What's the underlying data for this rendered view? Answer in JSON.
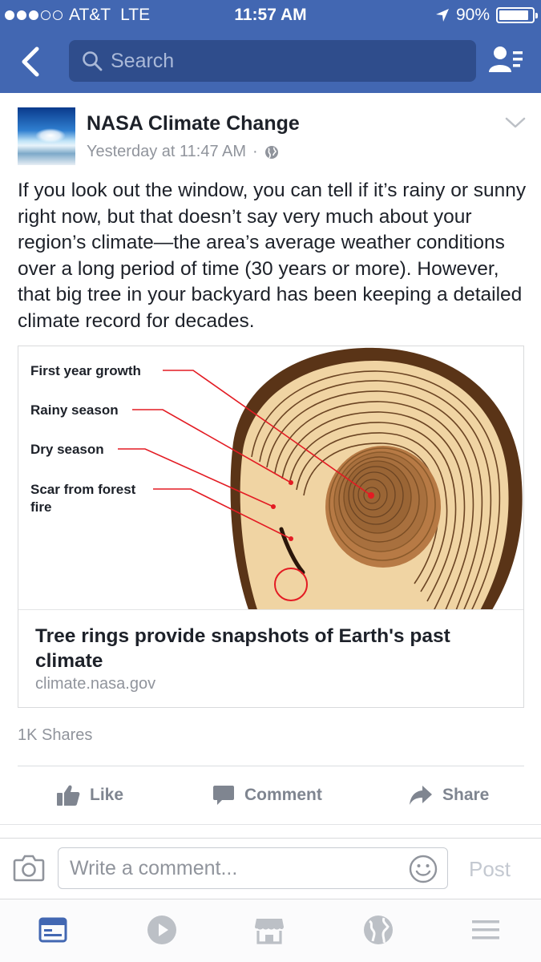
{
  "status_bar": {
    "signal_bars_filled": 3,
    "signal_bars_total": 5,
    "carrier": "AT&T",
    "network": "LTE",
    "time": "11:57 AM",
    "battery_text": "90%",
    "battery_level": 0.9
  },
  "nav": {
    "back_icon": "chevron-left-icon",
    "search_placeholder": "Search",
    "friends_icon": "friend-requests-icon"
  },
  "post": {
    "page_name": "NASA Climate Change",
    "timestamp": "Yesterday at 11:47 AM",
    "separator": "·",
    "audience_icon": "globe-icon",
    "text": "If you look out the window, you can tell if it’s rainy or sunny right now, but that doesn’t say very much about your region’s climate—the area’s average weather conditions over a long period of time (30 years or more). However, that big tree in your backyard has been keeping a detailed climate record for decades.",
    "link": {
      "image_labels": {
        "first_year": "First year growth",
        "rainy": "Rainy season",
        "dry": "Dry season",
        "scar_line1": "Scar from forest",
        "scar_line2": "fire"
      },
      "title": "Tree rings provide snapshots of Earth's past climate",
      "domain": "climate.nasa.gov"
    },
    "shares_text": "1K Shares"
  },
  "actions": {
    "like": "Like",
    "comment": "Comment",
    "share": "Share"
  },
  "composer": {
    "placeholder": "Write a comment...",
    "post_label": "Post"
  },
  "tab_bar": {
    "items": [
      "news-feed-icon",
      "video-icon",
      "marketplace-icon",
      "notifications-globe-icon",
      "menu-icon"
    ],
    "active_index": 0
  },
  "colors": {
    "brand_blue": "#4267b2",
    "search_field": "#2f4d8c",
    "muted_text": "#90949c",
    "action_gray": "#7f8590",
    "ring_light": "#f0d4a3",
    "ring_dark": "#8a5a2b",
    "bark": "#5a3417",
    "pointer_red": "#e31b23"
  }
}
